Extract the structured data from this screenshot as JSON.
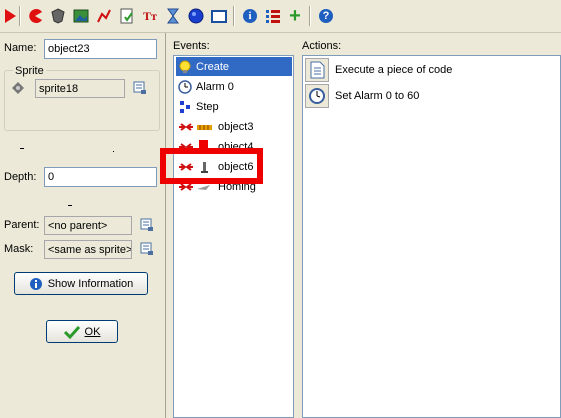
{
  "toolbar": {
    "icons": [
      "run-icon",
      "pacman-icon",
      "shield-icon",
      "image-icon",
      "path-icon",
      "script-icon",
      "font-icon",
      "timeline-icon",
      "object-icon",
      "room-icon",
      "info-icon",
      "list-icon",
      "add-icon",
      "help-icon"
    ],
    "font_glyph": "Tт",
    "help_glyph": "?",
    "info_glyph": "i",
    "add_glyph": "+"
  },
  "left": {
    "name_label": "Name:",
    "name_value": "object23",
    "sprite_group": "Sprite",
    "sprite_value": "sprite18",
    "depth_label": "Depth:",
    "depth_value": "0",
    "parent_label": "Parent:",
    "parent_value": "<no parent>",
    "mask_label": "Mask:",
    "mask_value": "<same as sprite>",
    "show_info_label": "Show Information",
    "ok_label": "OK"
  },
  "events": {
    "title": "Events:",
    "items": [
      {
        "label": "Create",
        "icon": "bulb-icon"
      },
      {
        "label": "Alarm 0",
        "icon": "clock-icon"
      },
      {
        "label": "Step",
        "icon": "step-icon"
      },
      {
        "label": "object3",
        "icon": "collision-icon"
      },
      {
        "label": "object4",
        "icon": "collision-icon"
      },
      {
        "label": "object6",
        "icon": "collision-icon"
      },
      {
        "label": "Homing",
        "icon": "collision-icon"
      }
    ]
  },
  "actions": {
    "title": "Actions:",
    "items": [
      {
        "label": "Execute a piece of code",
        "icon": "code-page-icon"
      },
      {
        "label": "Set Alarm 0 to 60",
        "icon": "alarm-clock-icon"
      }
    ]
  },
  "colors": {
    "highlight": "#ee0000",
    "selection": "#316ac5"
  }
}
